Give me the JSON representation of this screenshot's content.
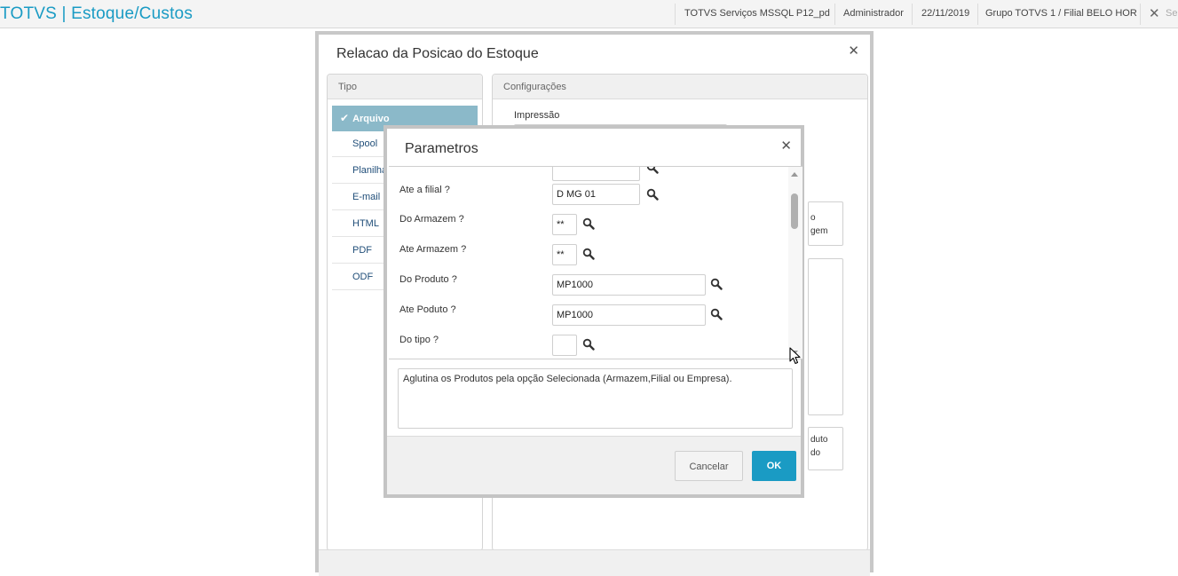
{
  "header": {
    "app_title": "TOTVS | Estoque/Custos",
    "environment": "TOTVS Serviços MSSQL P12_pd",
    "user": "Administrador",
    "date": "22/11/2019",
    "branch": "Grupo TOTVS 1 / Filial BELO HOR",
    "exit_label": "Se"
  },
  "main_dialog": {
    "title": "Relacao da Posicao do Estoque",
    "tipo_header": "Tipo",
    "tipo_items": [
      {
        "label": "Arquivo",
        "selected": true
      },
      {
        "label": "Spool"
      },
      {
        "label": "Planilha"
      },
      {
        "label": "E-mail"
      },
      {
        "label": "HTML"
      },
      {
        "label": "PDF"
      },
      {
        "label": "ODF"
      }
    ],
    "config_header": "Configurações",
    "impressao_label": "Impressão",
    "partial_box1": [
      "o",
      "gem"
    ],
    "partial_box2": [
      "duto",
      "do"
    ]
  },
  "params_dialog": {
    "title": "Parametros",
    "fields": [
      {
        "label": "Ate a filial ?",
        "value": "D MG 01"
      },
      {
        "label": "Do Armazem ?",
        "value": "**"
      },
      {
        "label": "Ate Armazem ?",
        "value": "**"
      },
      {
        "label": "Do Produto ?",
        "value": "MP1000"
      },
      {
        "label": "Ate Poduto ?",
        "value": "MP1000"
      },
      {
        "label": "Do tipo ?",
        "value": ""
      }
    ],
    "description": "Aglutina os Produtos pela opção Selecionada (Armazem,Filial ou Empresa).",
    "cancel_label": "Cancelar",
    "ok_label": "OK"
  }
}
